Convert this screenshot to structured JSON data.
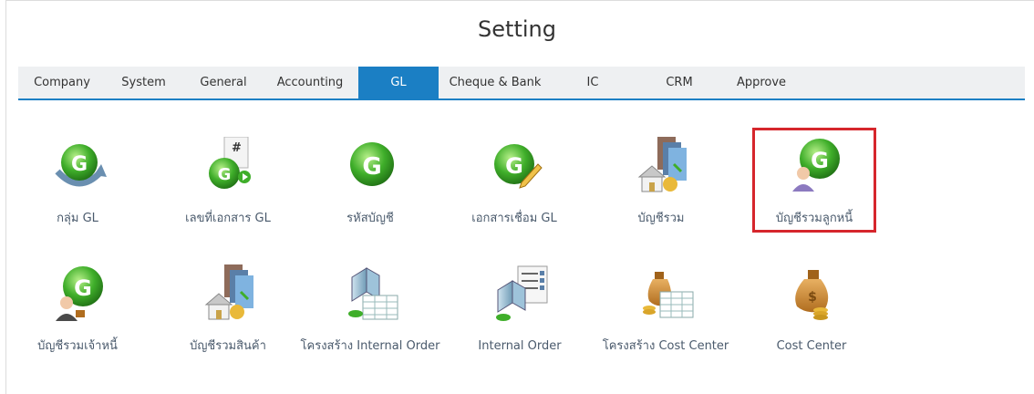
{
  "page": {
    "title": "Setting"
  },
  "tabs": [
    {
      "label": "Company"
    },
    {
      "label": "System"
    },
    {
      "label": "General"
    },
    {
      "label": "Accounting"
    },
    {
      "label": "GL",
      "active": true
    },
    {
      "label": "Cheque & Bank"
    },
    {
      "label": "IC"
    },
    {
      "label": "CRM"
    },
    {
      "label": "Approve"
    }
  ],
  "items": [
    {
      "label": "กลุ่ม GL",
      "icon": "gl-refresh-icon"
    },
    {
      "label": "เลขที่เอกสาร GL",
      "icon": "gl-document-number-icon"
    },
    {
      "label": "รหัสบัญชี",
      "icon": "gl-icon"
    },
    {
      "label": "เอกสารเชื่อม GL",
      "icon": "gl-pencil-icon"
    },
    {
      "label": "บัญชีรวม",
      "icon": "house-ledger-icon"
    },
    {
      "label": "บัญชีรวมลูกหนี้",
      "icon": "gl-customer-icon",
      "highlighted": true
    },
    {
      "label": "บัญชีรวมเจ้าหนี้",
      "icon": "gl-vendor-icon"
    },
    {
      "label": "บัญชีรวมสินค้า",
      "icon": "house-books-icon"
    },
    {
      "label": "โครงสร้าง Internal Order",
      "icon": "building-grid-icon"
    },
    {
      "label": "Internal Order",
      "icon": "building-list-icon"
    },
    {
      "label": "โครงสร้าง Cost Center",
      "icon": "money-bag-grid-icon"
    },
    {
      "label": "Cost Center",
      "icon": "money-bag-icon"
    }
  ],
  "colors": {
    "accent": "#1b7fc4",
    "highlight": "#d6262c",
    "gl_green": "#3fae2a"
  }
}
